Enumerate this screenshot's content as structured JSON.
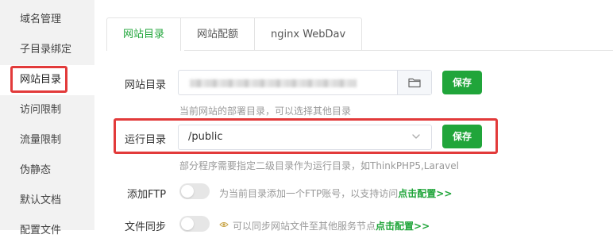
{
  "sidebar": {
    "items": [
      {
        "label": "域名管理"
      },
      {
        "label": "子目录绑定"
      },
      {
        "label": "网站目录"
      },
      {
        "label": "访问限制"
      },
      {
        "label": "流量限制"
      },
      {
        "label": "伪静态"
      },
      {
        "label": "默认文档"
      },
      {
        "label": "配置文件"
      }
    ]
  },
  "tabs": [
    {
      "label": "网站目录"
    },
    {
      "label": "网站配额"
    },
    {
      "label": "nginx WebDav"
    }
  ],
  "site_dir": {
    "label": "网站目录",
    "hint": "当前网站的部署目录，可以选择其他目录",
    "save_label": "保存"
  },
  "run_dir": {
    "label": "运行目录",
    "value": "/public",
    "hint": "部分程序需要指定二级目录作为运行目录，如ThinkPHP5,Laravel",
    "save_label": "保存"
  },
  "ftp": {
    "label": "添加FTP",
    "note": "为当前目录添加一个FTP账号，以支持访问",
    "link": "点击配置>>"
  },
  "file_sync": {
    "label": "文件同步",
    "note": "可以同步网站文件至其他服务节点",
    "link": "点击配置>>"
  },
  "colors": {
    "accent": "#20a53a",
    "highlight": "#e23a3a"
  }
}
